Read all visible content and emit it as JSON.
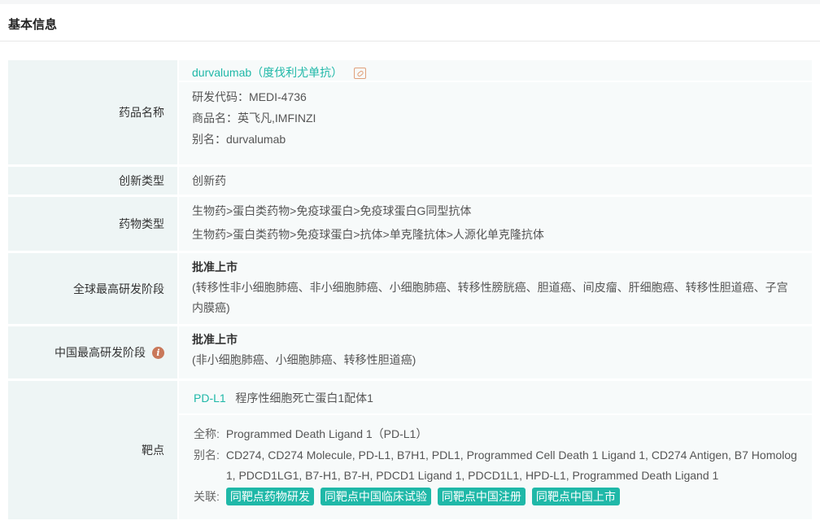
{
  "section_title": "基本信息",
  "drug": {
    "label": "药品名称",
    "name": "durvalumab（度伐利尤单抗）",
    "code": "研发代码：MEDI-4736",
    "trade": "商品名：英飞凡,IMFINZI",
    "alias": "别名：durvalumab"
  },
  "innovation": {
    "label": "创新类型",
    "value": "创新药"
  },
  "drug_type": {
    "label": "药物类型",
    "values": [
      "生物药>蛋白类药物>免疫球蛋白>免疫球蛋白G同型抗体",
      "生物药>蛋白类药物>免疫球蛋白>抗体>单克隆抗体>人源化单克隆抗体"
    ]
  },
  "global_stage": {
    "label": "全球最高研发阶段",
    "stage": "批准上市",
    "indications": "(转移性非小细胞肺癌、非小细胞肺癌、小细胞肺癌、转移性膀胱癌、胆道癌、间皮瘤、肝细胞癌、转移性胆道癌、子宫内膜癌)"
  },
  "china_stage": {
    "label": "中国最高研发阶段",
    "info_icon": "i",
    "stage": "批准上市",
    "indications": "(非小细胞肺癌、小细胞肺癌、转移性胆道癌)"
  },
  "target": {
    "label": "靶点",
    "symbol": "PD-L1",
    "name": "程序性细胞死亡蛋白1配体1",
    "fullname_label": "全称:",
    "fullname": "Programmed Death Ligand 1（PD-L1）",
    "alias_label": "别名:",
    "alias": "CD274, CD274 Molecule, PD-L1, B7H1, PDL1, Programmed Cell Death 1 Ligand 1, CD274 Antigen, B7 Homolog 1, PDCD1LG1, B7-H1, B7-H, PDCD1 Ligand 1, PDCD1L1, HPD-L1, Programmed Death Ligand 1",
    "related_label": "关联:",
    "tags": [
      "同靶点药物研发",
      "同靶点中国临床试验",
      "同靶点中国注册",
      "同靶点中国上市"
    ]
  }
}
